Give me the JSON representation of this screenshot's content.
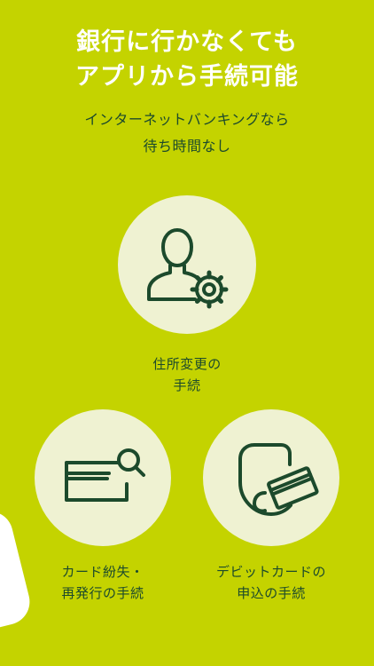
{
  "headline": {
    "line1": "銀行に行かなくても",
    "line2": "アプリから手続可能"
  },
  "subline": {
    "line1": "インターネットバンキングなら",
    "line2": "待ち時間なし"
  },
  "features": [
    {
      "icon": "user-settings-icon",
      "line1": "住所変更の",
      "line2": "手続"
    },
    {
      "icon": "card-search-icon",
      "line1": "カード紛失・",
      "line2": "再発行の手続"
    },
    {
      "icon": "debit-card-shield-icon",
      "line1": "デビットカードの",
      "line2": "申込の手続"
    }
  ],
  "colors": {
    "background": "#c4d300",
    "circle": "#eff2d2",
    "icon_stroke": "#1c4a2c",
    "headline_text": "#ffffff"
  }
}
